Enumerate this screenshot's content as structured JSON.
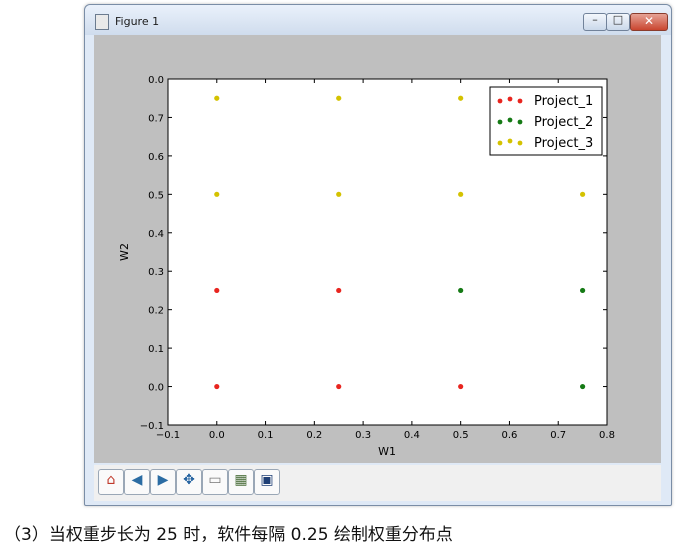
{
  "window": {
    "title": "Figure 1",
    "min_glyph": "–",
    "max_glyph": "□",
    "close_glyph": "✕"
  },
  "toolbar": {
    "tools": [
      {
        "name": "home-icon",
        "glyph": "⌂",
        "color": "#c0392b"
      },
      {
        "name": "back-icon",
        "glyph": "◀",
        "color": "#2b6ca3"
      },
      {
        "name": "forward-icon",
        "glyph": "▶",
        "color": "#2b6ca3"
      },
      {
        "name": "pan-icon",
        "glyph": "✥",
        "color": "#1f5f9e"
      },
      {
        "name": "zoom-icon",
        "glyph": "▭",
        "color": "#777777"
      },
      {
        "name": "subplots-icon",
        "glyph": "▦",
        "color": "#4a6e3a"
      },
      {
        "name": "save-icon",
        "glyph": "▣",
        "color": "#1f3f75"
      }
    ]
  },
  "chart_data": {
    "type": "scatter",
    "title": "",
    "xlabel": "W1",
    "ylabel": "W2",
    "xlim": [
      -0.1,
      0.8
    ],
    "ylim": [
      -0.1,
      0.8
    ],
    "y_inverted": true,
    "xticks": [
      "−0.1",
      "0.0",
      "0.1",
      "0.2",
      "0.3",
      "0.4",
      "0.5",
      "0.6",
      "0.7",
      "0.8"
    ],
    "yticks": [
      "−0.1",
      "0.0",
      "0.1",
      "0.2",
      "0.3",
      "0.4",
      "0.5",
      "0.6",
      "0.7",
      "0.0"
    ],
    "xtick_values": [
      -0.1,
      0.0,
      0.1,
      0.2,
      0.3,
      0.4,
      0.5,
      0.6,
      0.7,
      0.8
    ],
    "ytick_values": [
      -0.1,
      0.0,
      0.1,
      0.2,
      0.3,
      0.4,
      0.5,
      0.6,
      0.7,
      0.8
    ],
    "grid": false,
    "legend_position": "top-right",
    "series": [
      {
        "name": "Project_1",
        "color": "#e8251f",
        "points": [
          [
            0.0,
            0.0
          ],
          [
            0.25,
            0.0
          ],
          [
            0.5,
            0.0
          ],
          [
            0.0,
            0.25
          ],
          [
            0.25,
            0.25
          ]
        ]
      },
      {
        "name": "Project_2",
        "color": "#157a15",
        "points": [
          [
            0.75,
            0.0
          ],
          [
            0.5,
            0.25
          ],
          [
            0.75,
            0.25
          ]
        ]
      },
      {
        "name": "Project_3",
        "color": "#d4c200",
        "points": [
          [
            0.0,
            0.5
          ],
          [
            0.25,
            0.5
          ],
          [
            0.5,
            0.5
          ],
          [
            0.75,
            0.5
          ],
          [
            0.0,
            0.75
          ],
          [
            0.25,
            0.75
          ],
          [
            0.5,
            0.75
          ]
        ]
      }
    ]
  },
  "caption": "（3）当权重步长为 25 时，软件每隔 0.25 绘制权重分布点"
}
